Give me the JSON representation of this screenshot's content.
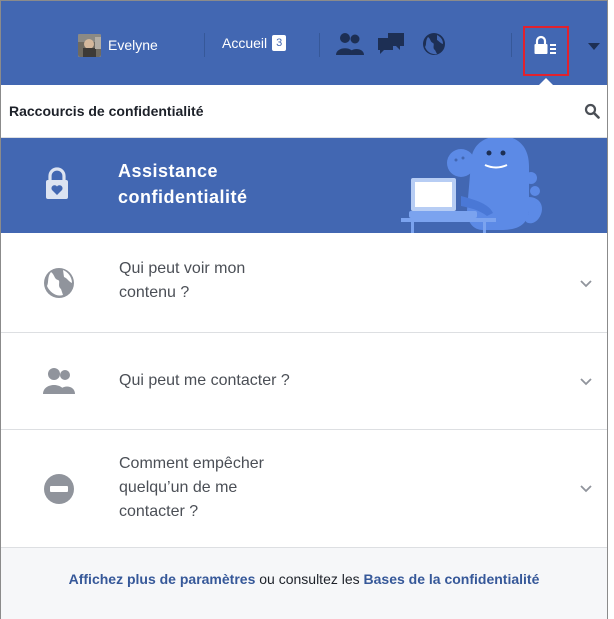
{
  "topbar": {
    "user_name": "Evelyne",
    "home_label": "Accueil",
    "home_badge": "3",
    "icons": [
      "friends-icon",
      "messages-icon",
      "notifications-globe-icon",
      "privacy-shortcuts-icon",
      "account-menu-arrow-icon"
    ]
  },
  "panel": {
    "title": "Raccourcis de confidentialité"
  },
  "banner": {
    "line1": "Assistance",
    "line2": "confidentialité"
  },
  "rows": [
    {
      "label_line1": "Qui peut voir mon",
      "label_line2": "contenu ?",
      "icon": "globe-icon"
    },
    {
      "label_line1": "Qui peut me contacter ?",
      "icon": "people-icon"
    },
    {
      "label_line1": "Comment empêcher",
      "label_line2": "quelqu’un de me",
      "label_line3": "contacter ?",
      "icon": "block-icon"
    }
  ],
  "footer": {
    "link1": "Affichez plus de paramètres",
    "middle": " ou consultez les ",
    "link2": "Bases de la confidentialité"
  },
  "colors": {
    "brand_blue": "#4267b2",
    "highlight_red": "#e1222e",
    "link_blue": "#365899"
  }
}
